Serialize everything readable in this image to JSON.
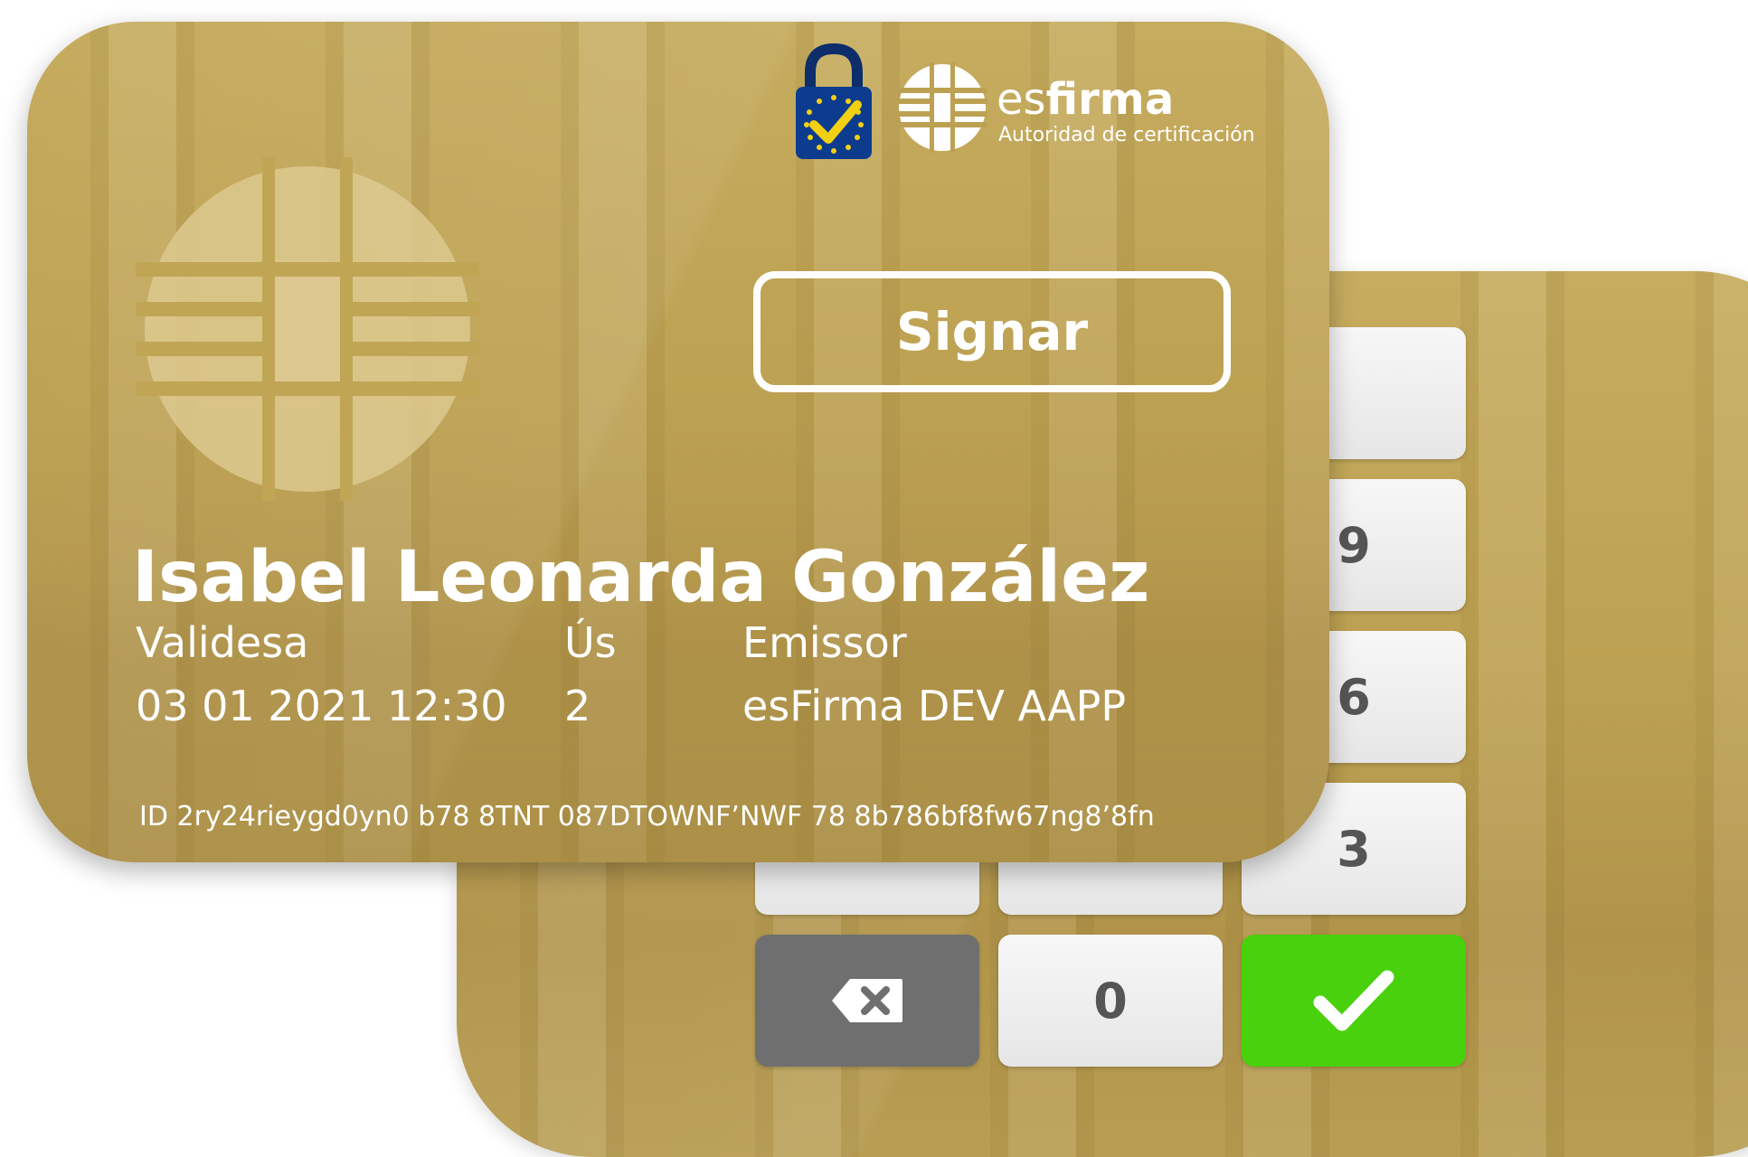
{
  "brand": {
    "name_prefix": "es",
    "name_bold": "firma",
    "subtitle": "Autoridad de certificación"
  },
  "card": {
    "sign_button_label": "Signar",
    "holder_name": "Isabel Leonarda González",
    "fields": {
      "validity_label": "Validesa",
      "validity_value": "03 01 2021 12:30",
      "uses_label": "Ús",
      "uses_value": "2",
      "issuer_label": "Emissor",
      "issuer_value": "esFirma DEV AAPP"
    },
    "id_line": "ID 2ry24rieygd0yn0 b78 8TNT 087DTOWNF’NWF 78 8b786bf8fw67ng8’8fn"
  },
  "keypad": {
    "visible_keys": [
      "9",
      "6",
      "3",
      "0"
    ],
    "delete_icon": "backspace-icon",
    "confirm_icon": "check-icon",
    "colors": {
      "confirm": "#48d10c",
      "delete": "#6f6f6f"
    }
  },
  "colors": {
    "card_gold": "#bda152"
  }
}
